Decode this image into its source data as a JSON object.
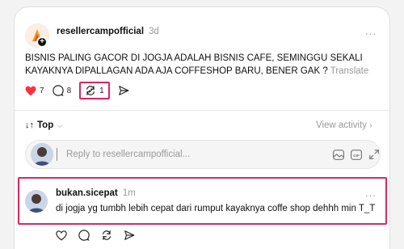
{
  "post": {
    "username": "resellercampofficial",
    "time": "3d",
    "more": "...",
    "text": "BISNIS PALING GACOR DI JOGJA ADALAH BISNIS CAFE, SEMINGGU SEKALI KAYAKNYA DIPALLAGAN ADA AJA COFFESHOP BARU, BENER GAK ?",
    "translate_label": "Translate",
    "likes": "7",
    "comments": "8",
    "reposts": "1",
    "accent": "#e3245b",
    "like_color": "#ff3040"
  },
  "sort": {
    "label": "Top",
    "view_activity": "View activity"
  },
  "composer": {
    "placeholder": "Reply to resellercampofficial..."
  },
  "reply": {
    "username": "bukan.sicepat",
    "time": "1m",
    "more": "...",
    "text": "di jogja yg tumbh lebih cepat dari rumput kayaknya coffe shop dehhh min T_T"
  }
}
